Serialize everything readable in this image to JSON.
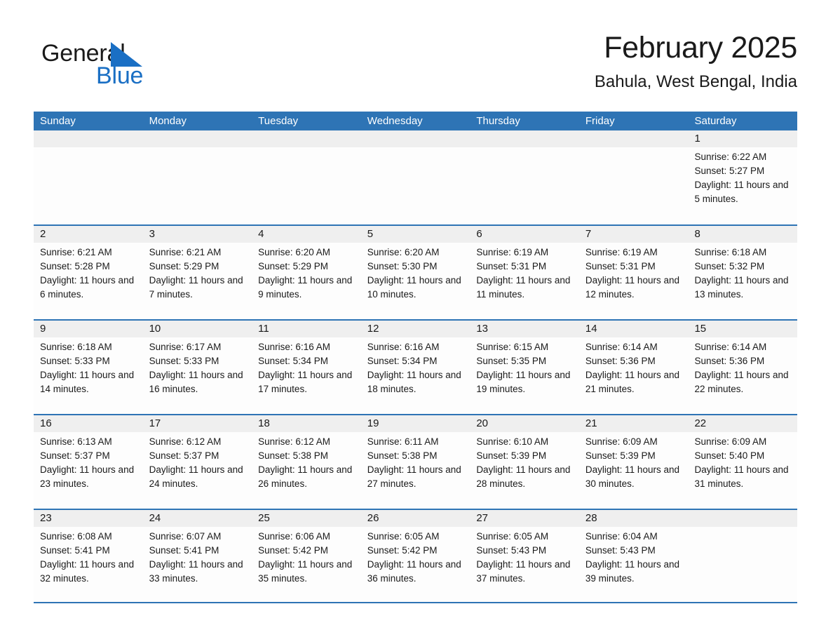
{
  "brand": {
    "name_part1": "General",
    "name_part2": "Blue",
    "triangle_color": "#1a6fc4"
  },
  "header": {
    "title": "February 2025",
    "subtitle": "Bahula, West Bengal, India"
  },
  "theme": {
    "header_blue": "#2e74b5",
    "daynum_band": "#efefef",
    "cell_bg": "#fdfdfd",
    "text": "#1a1a1a"
  },
  "weekdays": [
    "Sunday",
    "Monday",
    "Tuesday",
    "Wednesday",
    "Thursday",
    "Friday",
    "Saturday"
  ],
  "weeks": [
    [
      {
        "day": "",
        "info": ""
      },
      {
        "day": "",
        "info": ""
      },
      {
        "day": "",
        "info": ""
      },
      {
        "day": "",
        "info": ""
      },
      {
        "day": "",
        "info": ""
      },
      {
        "day": "",
        "info": ""
      },
      {
        "day": "1",
        "info": "Sunrise: 6:22 AM\nSunset: 5:27 PM\nDaylight: 11 hours and 5 minutes."
      }
    ],
    [
      {
        "day": "2",
        "info": "Sunrise: 6:21 AM\nSunset: 5:28 PM\nDaylight: 11 hours and 6 minutes."
      },
      {
        "day": "3",
        "info": "Sunrise: 6:21 AM\nSunset: 5:29 PM\nDaylight: 11 hours and 7 minutes."
      },
      {
        "day": "4",
        "info": "Sunrise: 6:20 AM\nSunset: 5:29 PM\nDaylight: 11 hours and 9 minutes."
      },
      {
        "day": "5",
        "info": "Sunrise: 6:20 AM\nSunset: 5:30 PM\nDaylight: 11 hours and 10 minutes."
      },
      {
        "day": "6",
        "info": "Sunrise: 6:19 AM\nSunset: 5:31 PM\nDaylight: 11 hours and 11 minutes."
      },
      {
        "day": "7",
        "info": "Sunrise: 6:19 AM\nSunset: 5:31 PM\nDaylight: 11 hours and 12 minutes."
      },
      {
        "day": "8",
        "info": "Sunrise: 6:18 AM\nSunset: 5:32 PM\nDaylight: 11 hours and 13 minutes."
      }
    ],
    [
      {
        "day": "9",
        "info": "Sunrise: 6:18 AM\nSunset: 5:33 PM\nDaylight: 11 hours and 14 minutes."
      },
      {
        "day": "10",
        "info": "Sunrise: 6:17 AM\nSunset: 5:33 PM\nDaylight: 11 hours and 16 minutes."
      },
      {
        "day": "11",
        "info": "Sunrise: 6:16 AM\nSunset: 5:34 PM\nDaylight: 11 hours and 17 minutes."
      },
      {
        "day": "12",
        "info": "Sunrise: 6:16 AM\nSunset: 5:34 PM\nDaylight: 11 hours and 18 minutes."
      },
      {
        "day": "13",
        "info": "Sunrise: 6:15 AM\nSunset: 5:35 PM\nDaylight: 11 hours and 19 minutes."
      },
      {
        "day": "14",
        "info": "Sunrise: 6:14 AM\nSunset: 5:36 PM\nDaylight: 11 hours and 21 minutes."
      },
      {
        "day": "15",
        "info": "Sunrise: 6:14 AM\nSunset: 5:36 PM\nDaylight: 11 hours and 22 minutes."
      }
    ],
    [
      {
        "day": "16",
        "info": "Sunrise: 6:13 AM\nSunset: 5:37 PM\nDaylight: 11 hours and 23 minutes."
      },
      {
        "day": "17",
        "info": "Sunrise: 6:12 AM\nSunset: 5:37 PM\nDaylight: 11 hours and 24 minutes."
      },
      {
        "day": "18",
        "info": "Sunrise: 6:12 AM\nSunset: 5:38 PM\nDaylight: 11 hours and 26 minutes."
      },
      {
        "day": "19",
        "info": "Sunrise: 6:11 AM\nSunset: 5:38 PM\nDaylight: 11 hours and 27 minutes."
      },
      {
        "day": "20",
        "info": "Sunrise: 6:10 AM\nSunset: 5:39 PM\nDaylight: 11 hours and 28 minutes."
      },
      {
        "day": "21",
        "info": "Sunrise: 6:09 AM\nSunset: 5:39 PM\nDaylight: 11 hours and 30 minutes."
      },
      {
        "day": "22",
        "info": "Sunrise: 6:09 AM\nSunset: 5:40 PM\nDaylight: 11 hours and 31 minutes."
      }
    ],
    [
      {
        "day": "23",
        "info": "Sunrise: 6:08 AM\nSunset: 5:41 PM\nDaylight: 11 hours and 32 minutes."
      },
      {
        "day": "24",
        "info": "Sunrise: 6:07 AM\nSunset: 5:41 PM\nDaylight: 11 hours and 33 minutes."
      },
      {
        "day": "25",
        "info": "Sunrise: 6:06 AM\nSunset: 5:42 PM\nDaylight: 11 hours and 35 minutes."
      },
      {
        "day": "26",
        "info": "Sunrise: 6:05 AM\nSunset: 5:42 PM\nDaylight: 11 hours and 36 minutes."
      },
      {
        "day": "27",
        "info": "Sunrise: 6:05 AM\nSunset: 5:43 PM\nDaylight: 11 hours and 37 minutes."
      },
      {
        "day": "28",
        "info": "Sunrise: 6:04 AM\nSunset: 5:43 PM\nDaylight: 11 hours and 39 minutes."
      },
      {
        "day": "",
        "info": ""
      }
    ]
  ]
}
